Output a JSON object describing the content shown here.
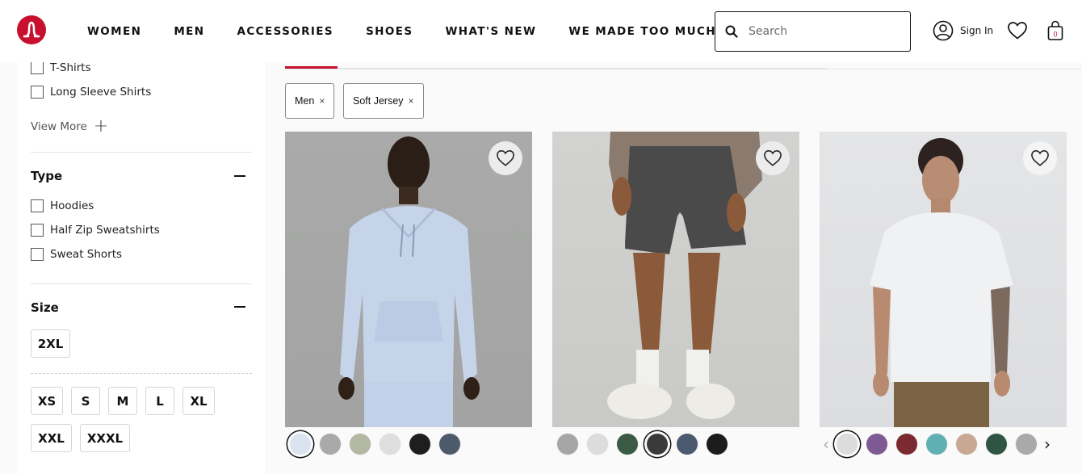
{
  "header": {
    "brand": "lululemon",
    "nav": [
      "WOMEN",
      "MEN",
      "ACCESSORIES",
      "SHOES",
      "WHAT'S NEW",
      "WE MADE TOO MUCH"
    ],
    "search_placeholder": "Search",
    "search_value": "",
    "sign_in": "Sign In",
    "bag_count": "0"
  },
  "sidebar": {
    "category_items": [
      "T-Shirts",
      "Long Sleeve Shirts"
    ],
    "view_more": "View More",
    "type": {
      "title": "Type",
      "items": [
        "Hoodies",
        "Half Zip Sweatshirts",
        "Sweat Shorts"
      ]
    },
    "size": {
      "title": "Size",
      "selected_group": [
        "2XL"
      ],
      "options_row1": [
        "XS",
        "S",
        "M",
        "L",
        "XL"
      ],
      "options_row2": [
        "XXL",
        "XXXL"
      ]
    }
  },
  "filters": {
    "chips": [
      "Men",
      "Soft Jersey"
    ],
    "remove_glyph": "×"
  },
  "products": [
    {
      "name": "hoodie",
      "swatches": [
        "#dbe3f0",
        "#a9a9a9",
        "#b3b8a2",
        "#dedede",
        "#1e1e1e",
        "#4d5a6a"
      ],
      "selected_swatch": 0
    },
    {
      "name": "shorts",
      "swatches": [
        "#a6a6a6",
        "#dcdcdc",
        "#3b5a46",
        "#3a3a3a",
        "#4c5a70",
        "#1c1c1c"
      ],
      "selected_swatch": 3
    },
    {
      "name": "t-shirt",
      "swatches": [
        "#dcdcde",
        "#7d5a94",
        "#7a2a30",
        "#5fb0b0",
        "#c8a793",
        "#2f5443",
        "#a9a9a9"
      ],
      "selected_swatch": 0,
      "has_carousel_arrows": true
    }
  ],
  "colors": {
    "brand_red": "#c8102e"
  }
}
